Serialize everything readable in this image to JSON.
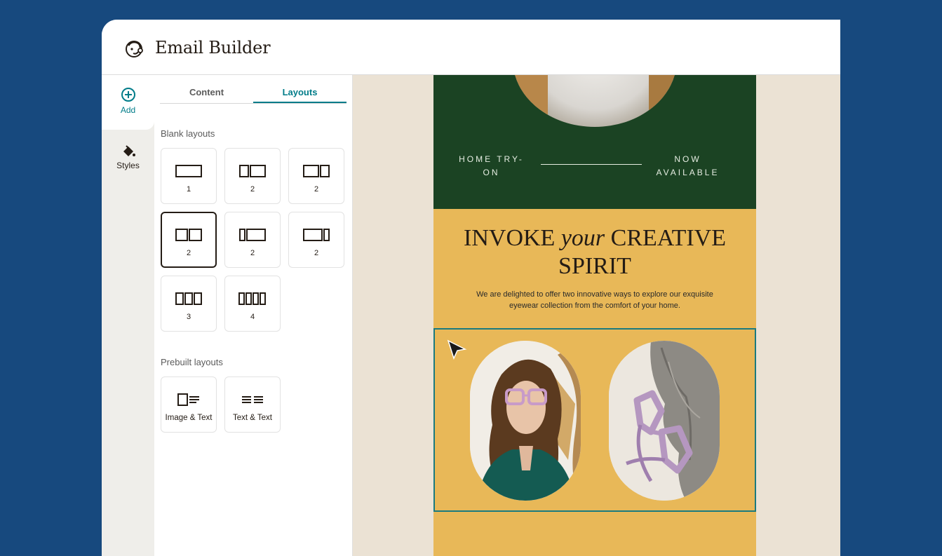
{
  "app": {
    "title": "Email Builder"
  },
  "rail": {
    "add_label": "Add",
    "styles_label": "Styles"
  },
  "panel": {
    "tabs": [
      {
        "label": "Content"
      },
      {
        "label": "Layouts"
      }
    ],
    "active_tab": "Layouts",
    "blank_title": "Blank layouts",
    "blank_layouts": [
      {
        "label": "1"
      },
      {
        "label": "2"
      },
      {
        "label": "2"
      },
      {
        "label": "2"
      },
      {
        "label": "2"
      },
      {
        "label": "2"
      },
      {
        "label": "3"
      },
      {
        "label": "4"
      }
    ],
    "selected_blank_index": 3,
    "prebuilt_title": "Prebuilt layouts",
    "prebuilt_layouts": [
      {
        "label": "Image & Text"
      },
      {
        "label": "Text & Text"
      }
    ]
  },
  "email": {
    "header_left": "HOME TRY-ON",
    "header_right": "NOW AVAILABLE",
    "headline_pre": "INVOKE ",
    "headline_italic": "your",
    "headline_post": " CREATIVE SPIRIT",
    "subtext": "We are delighted to offer two innovative ways to explore our exquisite eyewear collection from the comfort of your home."
  },
  "colors": {
    "background": "#17497e",
    "accent": "#007c89",
    "email_green": "#1b4323",
    "email_yellow": "#e8b858",
    "canvas_bg": "#ebe2d4",
    "selection_border": "#1a7a7f"
  },
  "icons": [
    "freddie-logo-icon",
    "plus-circle-icon",
    "paint-bucket-icon",
    "cursor-arrow-icon"
  ]
}
